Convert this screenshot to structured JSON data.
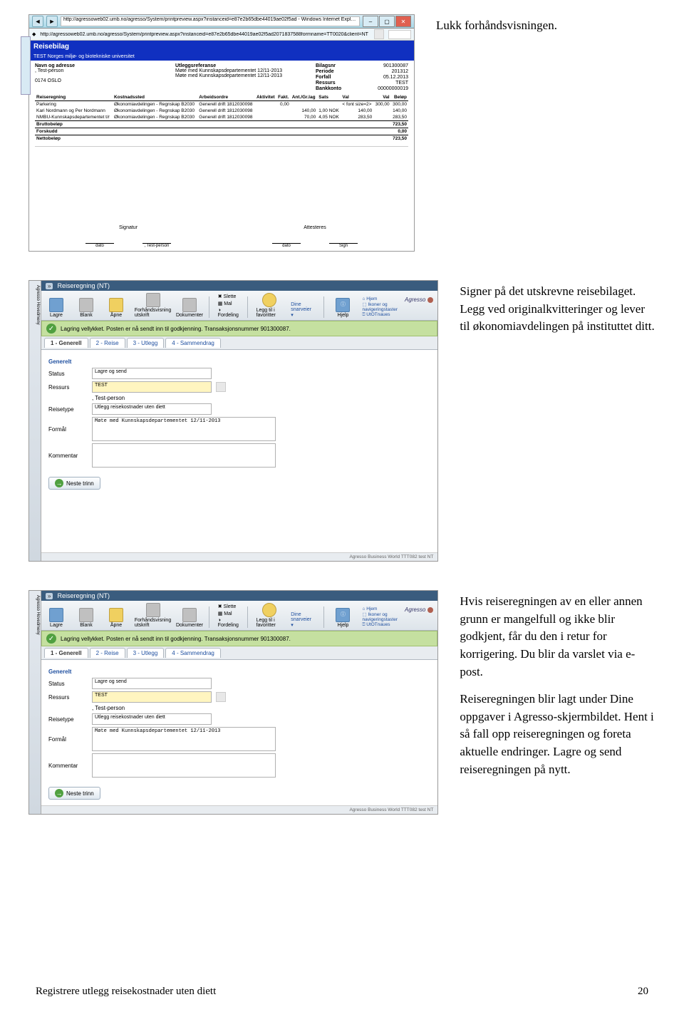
{
  "captions": {
    "c1": "Lukk forhåndsvisningen.",
    "c2a": "Signer på det utskrevne reisebilaget. Legg ved originalkvitteringer og lever til økonomiavdelingen på instituttet ditt.",
    "c3a": "Hvis reiseregningen av en eller annen grunn er mangelfull og ikke blir godkjent, får du den i retur for korrigering. Du blir da varslet via e-post.",
    "c3b": "Reiseregningen blir lagt under Dine oppgaver i Agresso-skjermbildet. Hent i så fall opp reiseregningen og foreta aktuelle endringer. Lagre og send reiseregningen på nytt."
  },
  "ie_window": {
    "url_top": "http://agressoweb02.umb.no/agresso/System/printpreview.aspx?instanceid=e87e2b65dbe44019ae02f5ad - Windows Internet Expl…",
    "url_sub": "http://agressoweb02.umb.no/agresso/System/printpreview.aspx?instanceid=e87e2b65dbe44019ae02f5ad2071837588formname=TT0020&client=NT"
  },
  "reisebilag": {
    "title": "Reisebilag",
    "subtitle": "TEST Norges miljø- og biotekniske universitet",
    "name_label": "Navn og adresse",
    "name_value": ", Test-person",
    "postal": "0174 OSLO",
    "utlegg_label": "Utleggsreferanse",
    "utlegg_l1": "Møte med Kunnskapsdepartementet 12/11-2013",
    "utlegg_l2": "Møte med Kunnskapsdepartementet 12/11-2013",
    "meta_labels": {
      "bilagsnr": "Bilagsnr",
      "periode": "Periode",
      "forfall": "Forfall",
      "ressurs": "Ressurs",
      "bankkonto": "Bankkonto"
    },
    "meta_values": {
      "bilagsnr": "901300087",
      "periode": "201312",
      "forfall": "05.12.2013",
      "ressurs": "TEST",
      "bankkonto": "00000000019"
    },
    "columns": [
      "Reiseregning",
      "Kostnadssted",
      "Arbeidsordre",
      "Aktivitet",
      "Fakt.",
      "Ant./Gr.lag",
      "Sats",
      "Val",
      "Val",
      "Beløp"
    ],
    "rows": [
      {
        "r": "Parkering",
        "k": "Økonomiavdelingen - Regnskap B2030",
        "a": "Generell drift 1812030098",
        "fakt": "0,00",
        "ant": "",
        "sats": "",
        "val1": "< font size=2>",
        "valamt": "300,00",
        "belop": "300,00"
      },
      {
        "r": "Kari Nordmann og Per Nordmann",
        "k": "Økonomiavdelingen - Regnskap B2030",
        "a": "Generell drift 1812030098",
        "fakt": "",
        "ant": "140,00",
        "sats": "1,00 NOK",
        "val1": "140,00",
        "valamt": "",
        "belop": "140,00"
      },
      {
        "r": "NMBU-Kunnskapsdepartementet t/r",
        "k": "Økonomiavdelingen - Regnskap B2030",
        "a": "Generell drift 1812030098",
        "fakt": "",
        "ant": "70,00",
        "sats": "4,05 NOK",
        "val1": "283,50",
        "valamt": "",
        "belop": "283,50"
      }
    ],
    "sums": {
      "brutto_label": "Bruttobeløp",
      "brutto": "723,50",
      "forskudd_label": "Forskudd",
      "forskudd": "0,00",
      "netto_label": "Nettobeløp",
      "netto": "723,50"
    },
    "sig": {
      "signatur": "Signatur",
      "dato": "dato",
      "testperson": ", Test-person",
      "attesteres": "Attesteres",
      "sign": "Sign"
    }
  },
  "reiseregning": {
    "window_title": "Reiseregning (NT)",
    "left_label": "Agresso Hovedmeny",
    "tabchar": "»",
    "toolbar": {
      "lagre": "Lagre",
      "blank": "Blank",
      "apne": "Åpne",
      "forhand": "Forhåndsvisning utskrift",
      "dokumenter": "Dokumenter",
      "slette": "Slette",
      "mal": "Mal",
      "fordeling": "Fordeling",
      "leggtil": "Legg til i favoritter",
      "dine": "Dine snarveier ▾",
      "hjelp": "Hjelp",
      "i_icon": "ⓘ",
      "hjem": "Hjem",
      "ikoner": "Ikoner og navigeringstaster",
      "utotnaues": "UtOTnaues"
    },
    "greenbar_text": "Lagring vellykket. Posten er nå sendt inn til godkjenning. Transaksjonsnummer 901300087.",
    "tabs": [
      "1 - Generell",
      "2 - Reise",
      "3 - Utlegg",
      "4 - Sammendrag"
    ],
    "group_title": "Generelt",
    "fields": {
      "status_label": "Status",
      "status_value": "Lagre og send",
      "ressurs_label": "Ressurs",
      "ressurs_value": "TEST",
      "ressurs_sub": ", Test-person",
      "reisetype_label": "Reisetype",
      "reisetype_value": "Utlegg reisekostnader uten diett",
      "formal_label": "Formål",
      "formal_value": "Møte med Kunnskapsdepartementet 12/11-2013",
      "kommentar_label": "Kommentar"
    },
    "neste": "Neste trinn",
    "statusbar": "Agresso Business World  TTT082  test  NT",
    "brand": "Agresso"
  },
  "footer": {
    "left": "Registrere utlegg reisekostnader uten diett",
    "right": "20"
  }
}
